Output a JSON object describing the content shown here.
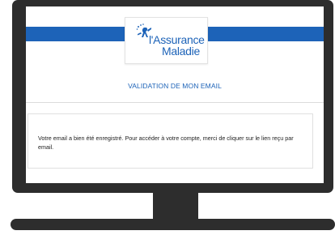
{
  "header": {
    "logo_name_line1": "l'Assurance",
    "logo_name_line2": "Maladie",
    "brand_color": "#1d63b8"
  },
  "main": {
    "title": "VALIDATION DE MON EMAIL",
    "message": "Votre email a bien été enregistré. Pour accéder à votre compte, merci de cliquer sur le lien reçu par email."
  },
  "icons": {
    "logo": "assurance-maladie-logo-icon"
  }
}
